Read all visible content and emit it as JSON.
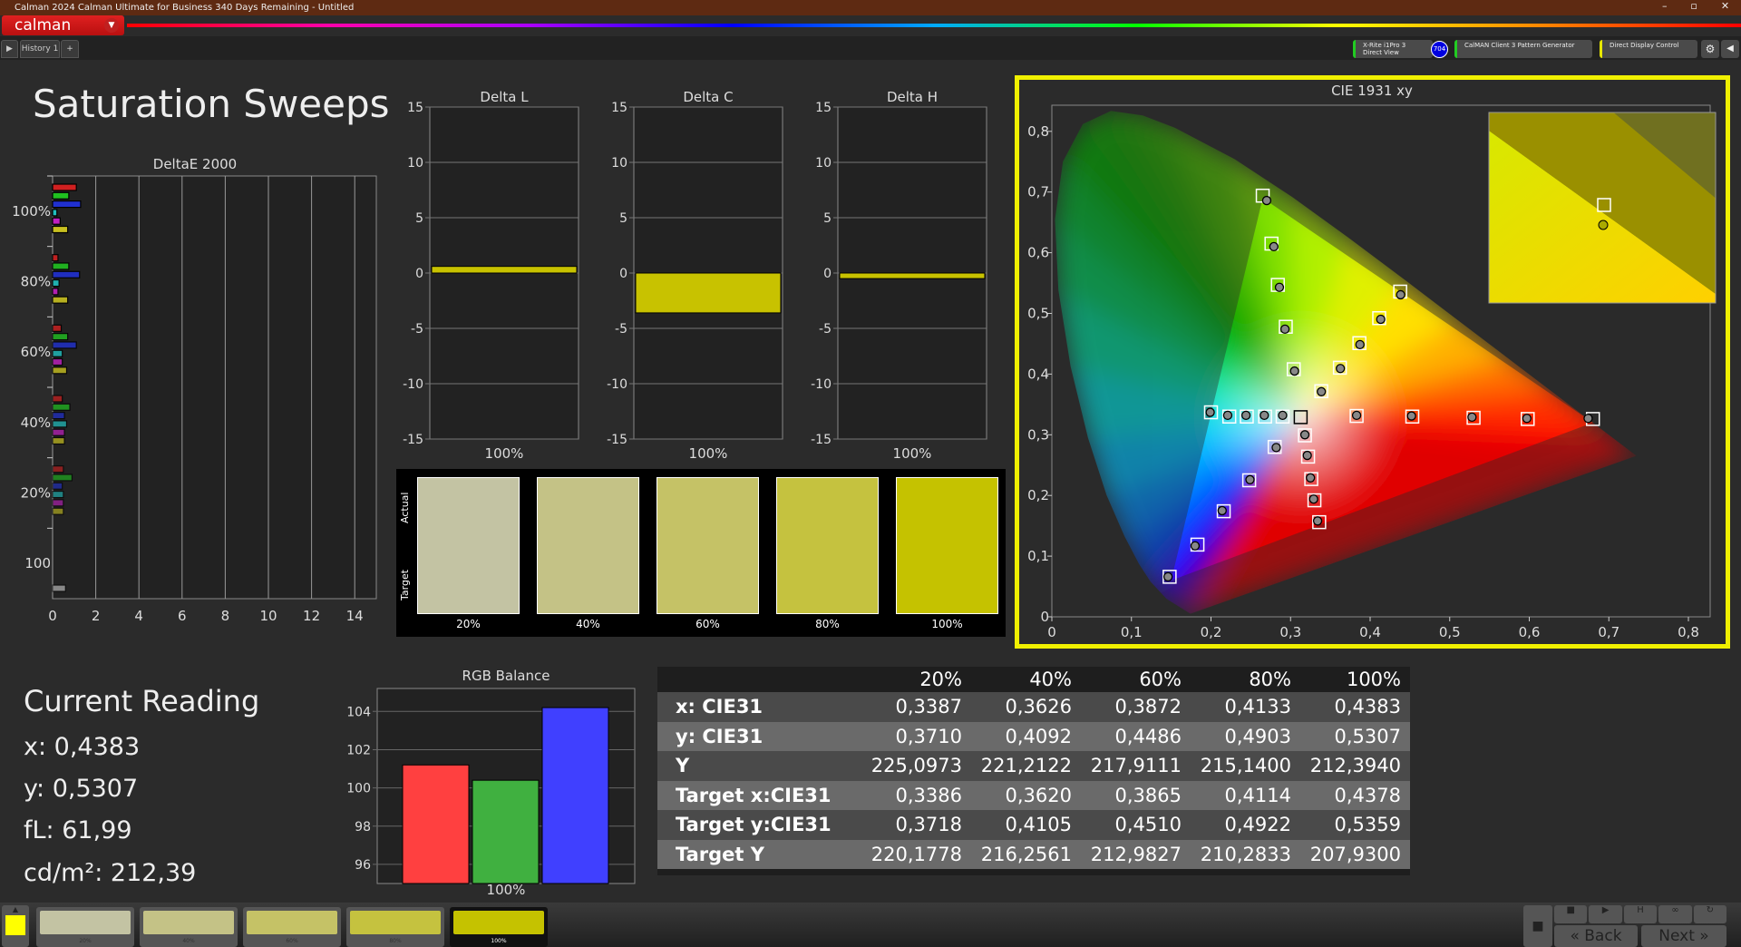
{
  "window": {
    "title": "Calman 2024 Calman Ultimate for Business 340 Days Remaining  - Untitled",
    "logo": "calman"
  },
  "tabs": {
    "history": "History 1",
    "add": "+"
  },
  "devices": [
    {
      "line1": "X-Rite i1Pro 3",
      "line2": "Direct View",
      "badge": "704",
      "color": "#22cc22"
    },
    {
      "line1": "CalMAN Client 3 Pattern Generator",
      "line2": "",
      "color": "#22cc22"
    },
    {
      "line1": "Direct Display Control",
      "line2": "",
      "color": "#e8e800"
    }
  ],
  "page": {
    "title": "Saturation Sweeps"
  },
  "deltae": {
    "title": "DeltaE 2000",
    "xticks": [
      "0",
      "2",
      "4",
      "6",
      "8",
      "10",
      "12",
      "14"
    ],
    "xlim": [
      0,
      15
    ],
    "groups": [
      {
        "label": "100%",
        "values": [
          1.1,
          0.75,
          1.3,
          0.2,
          0.35,
          0.7
        ]
      },
      {
        "label": "80%",
        "values": [
          0.25,
          0.75,
          1.25,
          0.3,
          0.25,
          0.7
        ]
      },
      {
        "label": "60%",
        "values": [
          0.4,
          0.7,
          1.1,
          0.45,
          0.45,
          0.65
        ]
      },
      {
        "label": "40%",
        "values": [
          0.45,
          0.8,
          0.55,
          0.65,
          0.55,
          0.55
        ]
      },
      {
        "label": "20%",
        "values": [
          0.5,
          0.9,
          0.45,
          0.5,
          0.5,
          0.5
        ]
      },
      {
        "label": "100",
        "values": [
          0.6
        ]
      }
    ],
    "colors": [
      "#d02020",
      "#20c020",
      "#2030d0",
      "#20c0c0",
      "#c020c0",
      "#c8c020"
    ]
  },
  "deltas": [
    {
      "title": "Delta L",
      "value": 0.6,
      "label": "100%"
    },
    {
      "title": "Delta C",
      "value": -3.6,
      "label": "100%"
    },
    {
      "title": "Delta H",
      "value": -0.5,
      "label": "100%"
    }
  ],
  "deltas_yticks": [
    "15",
    "10",
    "5",
    "0",
    "-5",
    "-10",
    "-15"
  ],
  "swatches": {
    "actual_label": "Actual",
    "target_label": "Target",
    "items": [
      {
        "label": "20%",
        "color": "#c3c3a3"
      },
      {
        "label": "40%",
        "color": "#c4c286"
      },
      {
        "label": "60%",
        "color": "#c5c266"
      },
      {
        "label": "80%",
        "color": "#c5c23f"
      },
      {
        "label": "100%",
        "color": "#c5c200"
      }
    ]
  },
  "chart_data": {
    "type": "scatter",
    "title": "CIE 1931 xy",
    "xlim": [
      0,
      0.8
    ],
    "ylim": [
      0,
      0.85
    ],
    "xticks": [
      "0",
      "0,1",
      "0,2",
      "0,3",
      "0,4",
      "0,5",
      "0,6",
      "0,7",
      "0,8"
    ],
    "yticks": [
      "0",
      "0,1",
      "0,2",
      "0,3",
      "0,4",
      "0,5",
      "0,6",
      "0,7",
      "0,8"
    ],
    "white": [
      0.3127,
      0.329
    ],
    "targets": {
      "red": [
        [
          0.383,
          0.331
        ],
        [
          0.453,
          0.33
        ],
        [
          0.53,
          0.328
        ],
        [
          0.598,
          0.326
        ],
        [
          0.68,
          0.326
        ]
      ],
      "green": [
        [
          0.304,
          0.408
        ],
        [
          0.294,
          0.478
        ],
        [
          0.284,
          0.547
        ],
        [
          0.276,
          0.615
        ],
        [
          0.265,
          0.694
        ]
      ],
      "blue": [
        [
          0.28,
          0.28
        ],
        [
          0.248,
          0.225
        ],
        [
          0.216,
          0.174
        ],
        [
          0.183,
          0.119
        ],
        [
          0.148,
          0.066
        ]
      ],
      "cyan": [
        [
          0.29,
          0.33
        ],
        [
          0.268,
          0.33
        ],
        [
          0.245,
          0.33
        ],
        [
          0.223,
          0.33
        ],
        [
          0.2,
          0.337
        ]
      ],
      "magenta": [
        [
          0.318,
          0.299
        ],
        [
          0.322,
          0.264
        ],
        [
          0.326,
          0.227
        ],
        [
          0.33,
          0.192
        ],
        [
          0.336,
          0.156
        ]
      ],
      "yellow": [
        [
          0.3386,
          0.3718
        ],
        [
          0.362,
          0.4105
        ],
        [
          0.3865,
          0.451
        ],
        [
          0.4114,
          0.4922
        ],
        [
          0.4378,
          0.5359
        ]
      ]
    },
    "measured": {
      "red": [
        [
          0.383,
          0.332
        ],
        [
          0.452,
          0.331
        ],
        [
          0.528,
          0.329
        ],
        [
          0.597,
          0.327
        ],
        [
          0.674,
          0.327
        ]
      ],
      "green": [
        [
          0.305,
          0.405
        ],
        [
          0.293,
          0.474
        ],
        [
          0.286,
          0.543
        ],
        [
          0.279,
          0.61
        ],
        [
          0.27,
          0.686
        ]
      ],
      "blue": [
        [
          0.282,
          0.279
        ],
        [
          0.249,
          0.226
        ],
        [
          0.214,
          0.175
        ],
        [
          0.18,
          0.117
        ],
        [
          0.146,
          0.066
        ]
      ],
      "cyan": [
        [
          0.29,
          0.332
        ],
        [
          0.267,
          0.332
        ],
        [
          0.244,
          0.332
        ],
        [
          0.221,
          0.332
        ],
        [
          0.199,
          0.337
        ]
      ],
      "magenta": [
        [
          0.318,
          0.3
        ],
        [
          0.321,
          0.266
        ],
        [
          0.325,
          0.229
        ],
        [
          0.329,
          0.194
        ],
        [
          0.334,
          0.158
        ]
      ],
      "yellow": [
        [
          0.3387,
          0.371
        ],
        [
          0.3626,
          0.4092
        ],
        [
          0.3872,
          0.4486
        ],
        [
          0.4133,
          0.4903
        ],
        [
          0.4383,
          0.5307
        ]
      ]
    }
  },
  "current": {
    "title": "Current Reading",
    "x": "x: 0,4383",
    "y": "y: 0,5307",
    "fl": "fL: 61,99",
    "cd": "cd/m²: 212,39"
  },
  "rgb": {
    "title": "RGB Balance",
    "label": "100%",
    "yticks": [
      "104",
      "102",
      "100",
      "98",
      "96"
    ],
    "ylim": [
      95,
      105.2
    ],
    "values": [
      101.2,
      100.4,
      104.2
    ],
    "colors": [
      "#ff4040",
      "#40b040",
      "#4040ff"
    ]
  },
  "table": {
    "headers": [
      "20%",
      "40%",
      "60%",
      "80%",
      "100%"
    ],
    "rows": [
      {
        "label": "x: CIE31",
        "values": [
          "0,3387",
          "0,3626",
          "0,3872",
          "0,4133",
          "0,4383"
        ]
      },
      {
        "label": "y: CIE31",
        "values": [
          "0,3710",
          "0,4092",
          "0,4486",
          "0,4903",
          "0,5307"
        ]
      },
      {
        "label": "Y",
        "values": [
          "225,0973",
          "221,2122",
          "217,9111",
          "215,1400",
          "212,3940"
        ]
      },
      {
        "label": "Target x:CIE31",
        "values": [
          "0,3386",
          "0,3620",
          "0,3865",
          "0,4114",
          "0,4378"
        ]
      },
      {
        "label": "Target y:CIE31",
        "values": [
          "0,3718",
          "0,4105",
          "0,4510",
          "0,4922",
          "0,5359"
        ]
      },
      {
        "label": "Target Y",
        "values": [
          "220,1778",
          "216,2561",
          "212,9827",
          "210,2833",
          "207,9300"
        ]
      }
    ]
  },
  "bottom": {
    "swatches": [
      {
        "label": "20%",
        "color": "#c3c3a3"
      },
      {
        "label": "40%",
        "color": "#c4c286"
      },
      {
        "label": "60%",
        "color": "#c5c266"
      },
      {
        "label": "80%",
        "color": "#c5c23f"
      },
      {
        "label": "100%",
        "color": "#c5c200"
      }
    ],
    "current_color": "#ffff00",
    "back": "Back",
    "next": "Next"
  }
}
